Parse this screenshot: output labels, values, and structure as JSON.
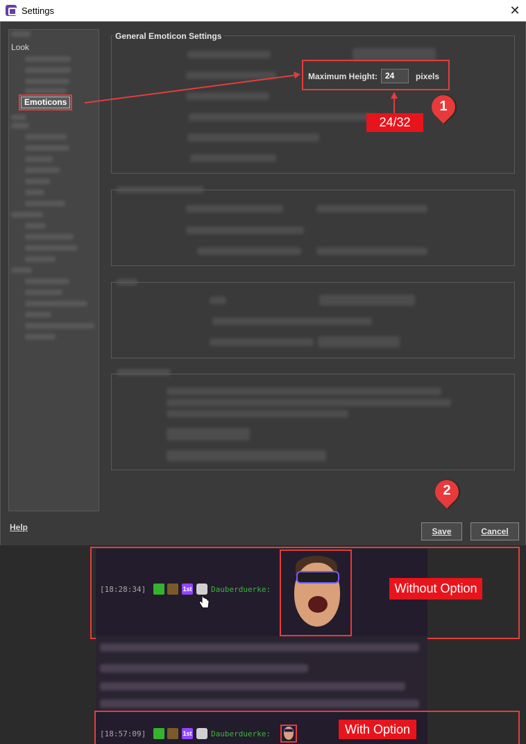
{
  "window": {
    "title": "Settings",
    "close_glyph": "✕"
  },
  "sidebar": {
    "look_label": "Look",
    "selected_item": "Emoticons"
  },
  "sections": {
    "general_title": "General Emoticon Settings"
  },
  "max_height": {
    "label": "Maximum Height:",
    "value": "24",
    "unit": "pixels"
  },
  "annotations": {
    "values_hint": "24/32",
    "step1": "1",
    "step2": "2",
    "without_option": "Without Option",
    "with_option": "With Option"
  },
  "footer": {
    "help_label": "Help",
    "save_label": "Save",
    "cancel_label": "Cancel"
  },
  "chat": {
    "top": {
      "timestamp": "[18:28:34]",
      "username": "Dauberduerke:",
      "first_badge": "1st"
    },
    "bottom": {
      "timestamp": "[18:57:09]",
      "username": "Dauberduerke:",
      "first_badge": "1st"
    }
  },
  "colors": {
    "accent_red": "#e53c3c",
    "callout_red": "#e8141c",
    "username_green": "#3cb43c",
    "badge_purple": "#9146ff"
  }
}
